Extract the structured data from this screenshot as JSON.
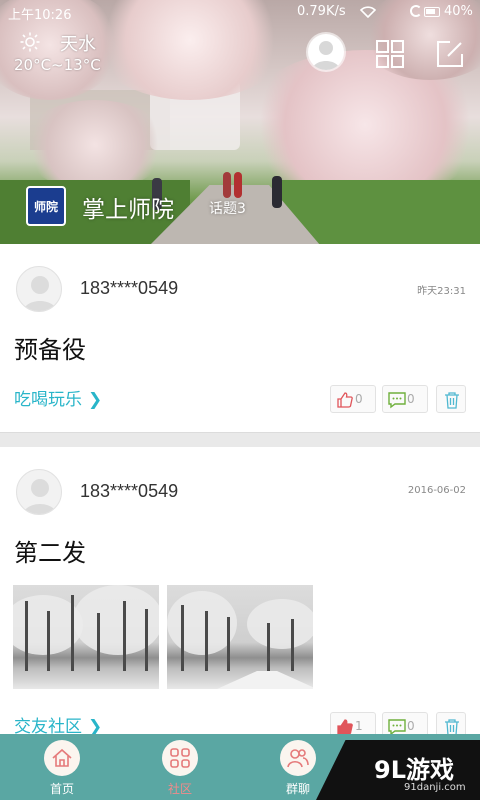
{
  "status_bar": {
    "time": "上午10:26",
    "network_speed": "0.79K/s",
    "battery": "40%"
  },
  "weather": {
    "icon": "sun-icon",
    "city": "天水",
    "temperature": "20°C~13°C"
  },
  "header": {
    "avatar_icon": "user-avatar-icon",
    "grid_icon": "grid-icon",
    "edit_icon": "compose-icon"
  },
  "brand": {
    "logo_text": "师院",
    "app_name": "掌上师院",
    "topics": "话题3"
  },
  "posts": [
    {
      "user": "183****0549",
      "time": "昨天23:31",
      "title": "预备役",
      "category": "吃喝玩乐",
      "arrow": "❯",
      "likes": "0",
      "comments": "0",
      "liked": false
    },
    {
      "user": "183****0549",
      "time": "2016-06-02",
      "title": "第二发",
      "category": "交友社区",
      "arrow": "❯",
      "likes": "1",
      "comments": "0",
      "liked": true,
      "photos": [
        "snowy-trees-photo",
        "snowy-road-photo"
      ]
    }
  ],
  "bottom_nav": [
    {
      "label": "首页",
      "icon": "home-icon",
      "active": false
    },
    {
      "label": "社区",
      "icon": "community-icon",
      "active": true
    },
    {
      "label": "群聊",
      "icon": "group-chat-icon",
      "active": false
    }
  ],
  "watermark": {
    "main": "9L游戏",
    "sub": "91danji.com"
  },
  "colors": {
    "accent": "#29b5c9",
    "nav_bg": "#5aa7a3",
    "nav_active": "#f08b8b",
    "like_red": "#e0555a",
    "comment_green": "#6fb03c"
  }
}
